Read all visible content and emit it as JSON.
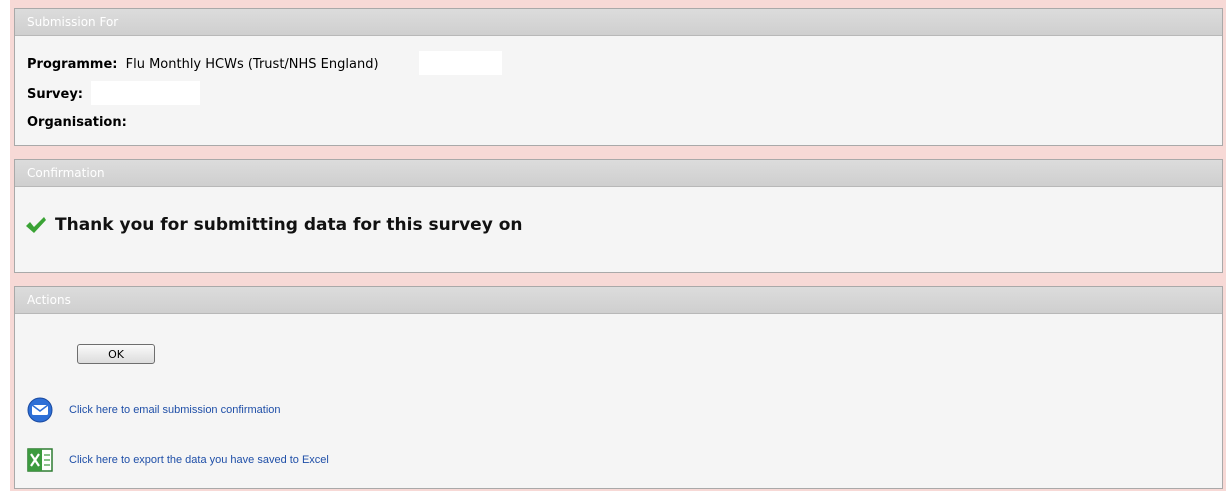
{
  "submission_panel": {
    "title": "Submission For",
    "programme_label": "Programme:",
    "programme_value": "Flu Monthly HCWs (Trust/NHS England)",
    "survey_label": "Survey:",
    "organisation_label": "Organisation:"
  },
  "confirmation_panel": {
    "title": "Confirmation",
    "message": "Thank you for submitting data for this survey on",
    "icon": "checkmark-icon"
  },
  "actions_panel": {
    "title": "Actions",
    "ok_label": "OK",
    "email_link": "Click here to email submission confirmation",
    "email_icon": "email-icon",
    "export_link": "Click here to export the data you have saved to Excel",
    "export_icon": "excel-icon"
  },
  "colors": {
    "page_background": "#f7d9d6",
    "panel_background": "#f5f5f5",
    "header_background": "#d5d5d5",
    "link": "#1f4fa8",
    "check": "#3aa335"
  }
}
